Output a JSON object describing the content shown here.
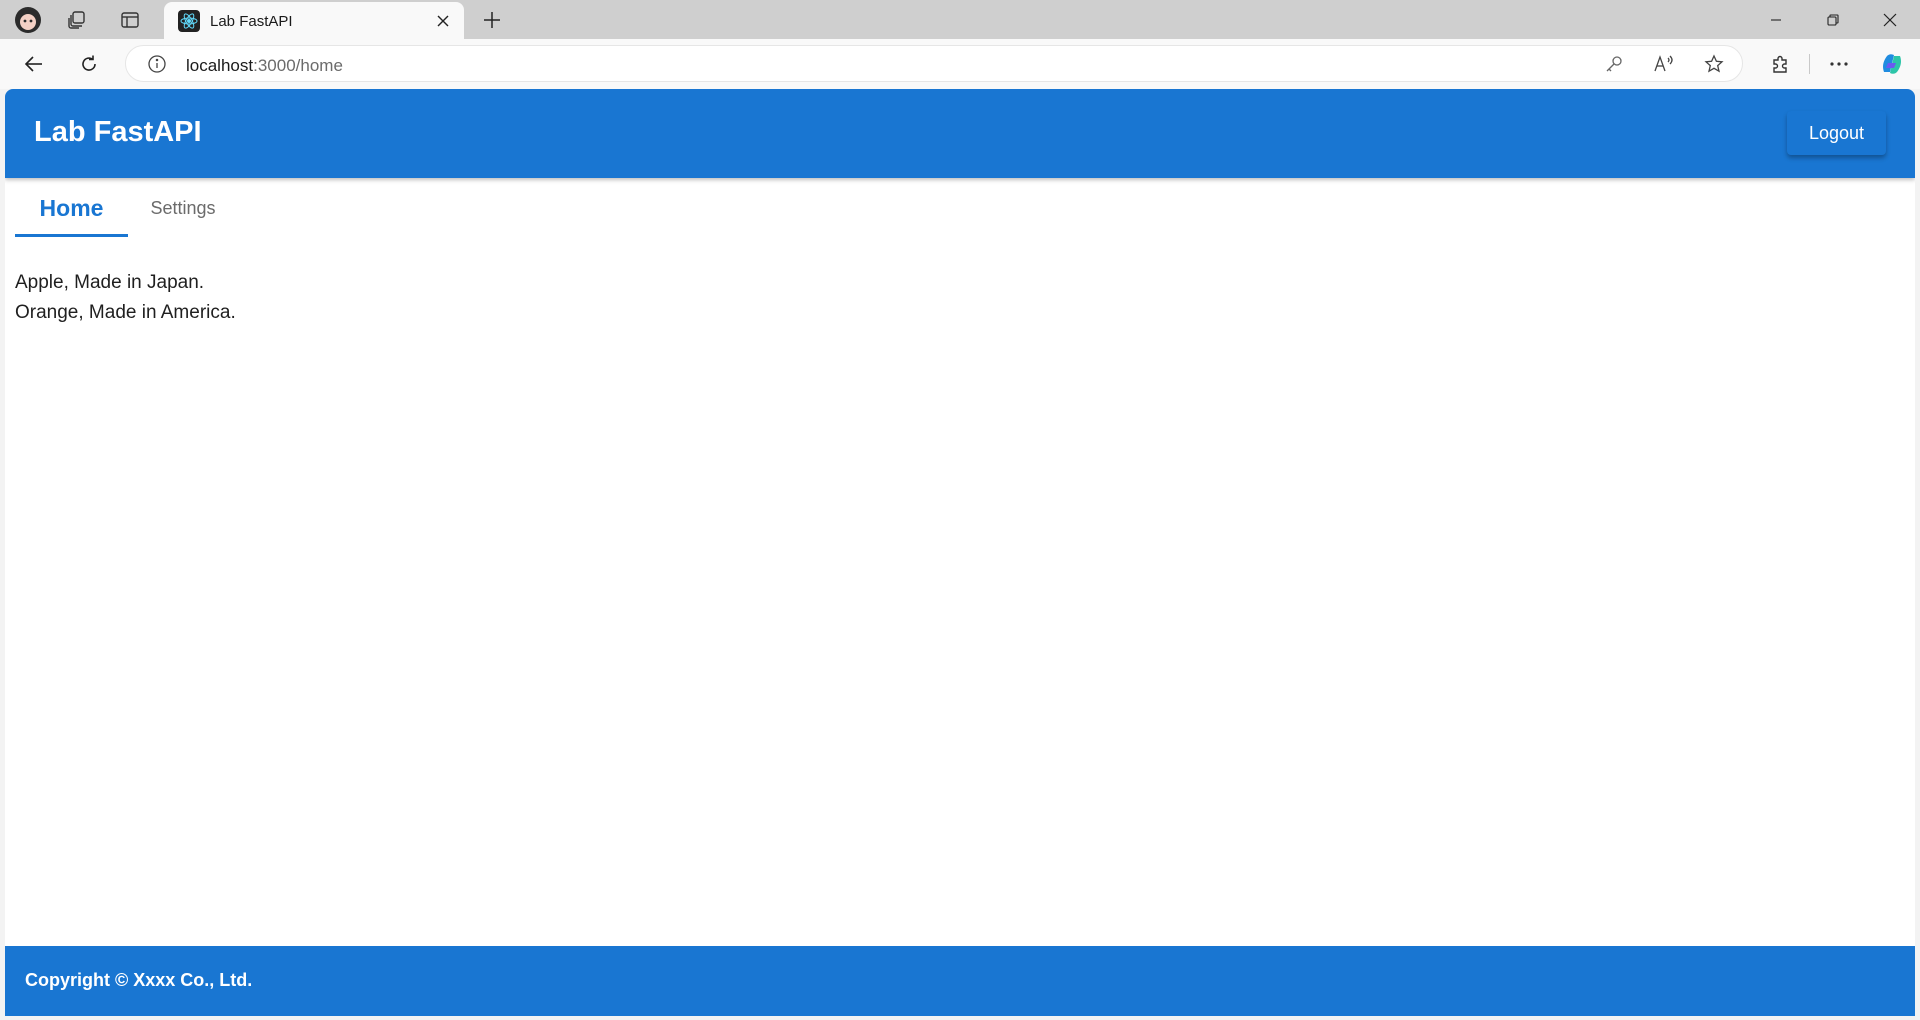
{
  "browser": {
    "tab_title": "Lab FastAPI",
    "url_host": "localhost",
    "url_rest": ":3000/home",
    "icons": [
      "profile-icon",
      "workspaces-icon",
      "tab-actions-icon",
      "react-favicon",
      "close-icon",
      "new-tab-icon",
      "minimize-icon",
      "restore-icon",
      "window-close-icon",
      "back-icon",
      "refresh-icon",
      "site-info-icon",
      "key-icon",
      "read-aloud-icon",
      "favorite-star-icon",
      "extensions-icon",
      "more-icon",
      "copilot-icon"
    ]
  },
  "app": {
    "title": "Lab FastAPI",
    "logout_label": "Logout",
    "brand_color": "#1976d2"
  },
  "nav": {
    "tabs": [
      {
        "label": "Home",
        "active": true
      },
      {
        "label": "Settings",
        "active": false
      }
    ]
  },
  "content": {
    "lines": [
      "Apple, Made in Japan.",
      "Orange, Made in America."
    ]
  },
  "footer": {
    "text": "Copyright © Xxxx Co., Ltd."
  }
}
